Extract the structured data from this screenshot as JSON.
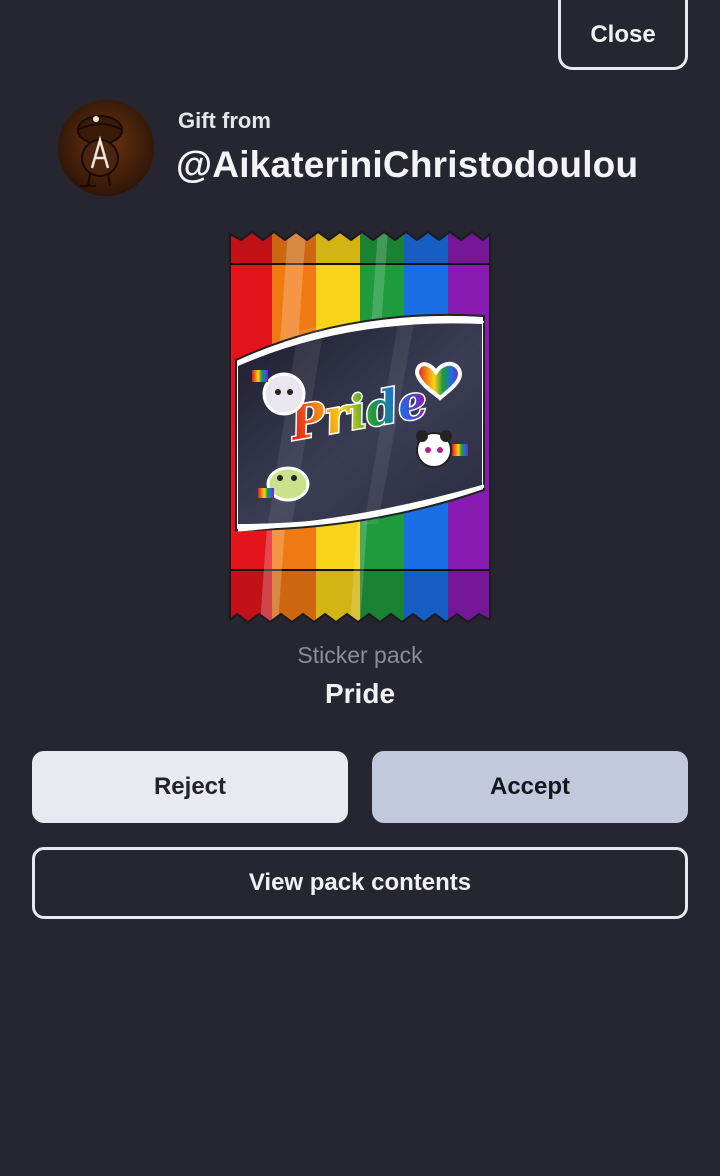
{
  "header": {
    "close_label": "Close"
  },
  "gift": {
    "label": "Gift from",
    "username": "@AikateriniChristodoulou"
  },
  "pack": {
    "artwork_text": "Pride",
    "type_label": "Sticker pack",
    "name": "Pride",
    "stripe_colors": [
      "#e4141c",
      "#f07a12",
      "#f7d417",
      "#1f9a3c",
      "#1a6fe6",
      "#8a1bb2"
    ]
  },
  "actions": {
    "reject_label": "Reject",
    "accept_label": "Accept",
    "view_contents_label": "View pack contents"
  },
  "colors": {
    "background": "#25262f",
    "accept": "#c2c9dc",
    "reject": "#e8e9f1"
  }
}
